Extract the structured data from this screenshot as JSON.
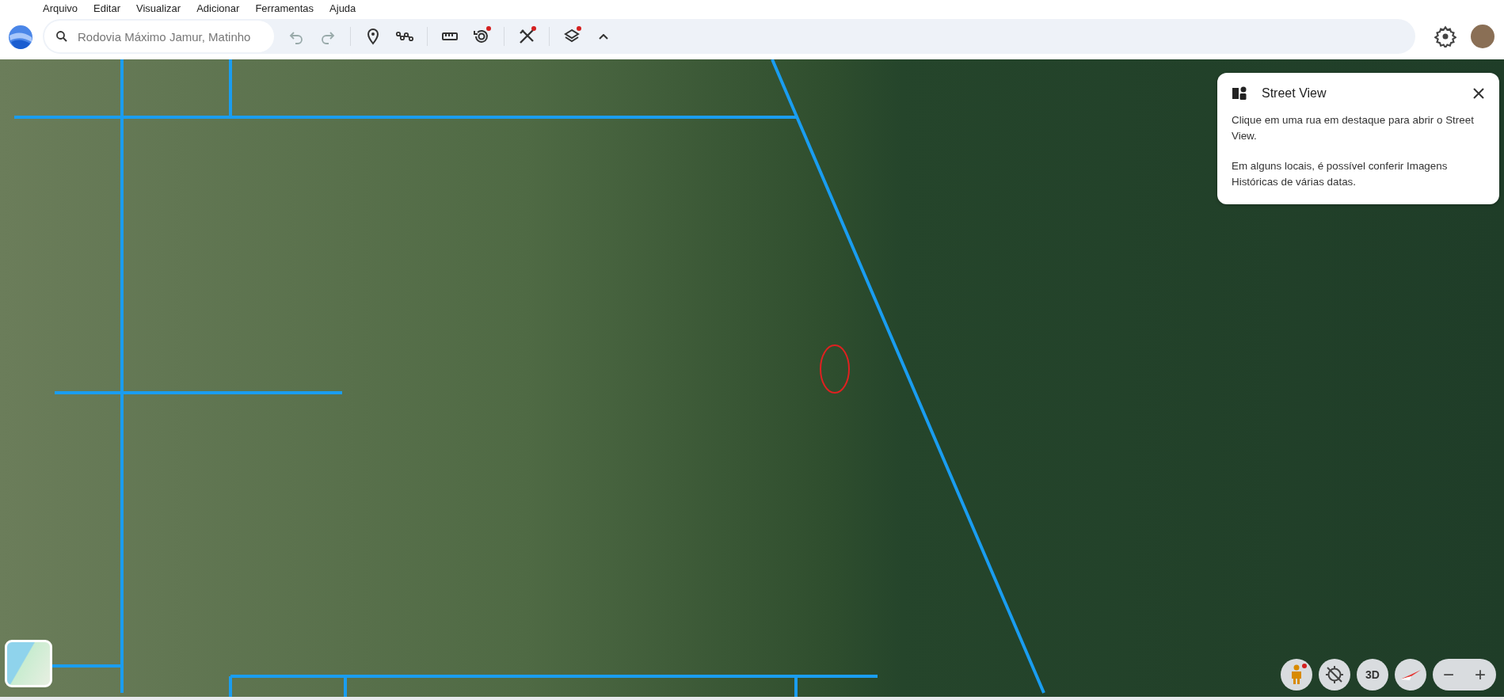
{
  "menu": [
    "Arquivo",
    "Editar",
    "Visualizar",
    "Adicionar",
    "Ferramentas",
    "Ajuda"
  ],
  "search": {
    "value": "Rodovia Máximo Jamur, Matinho"
  },
  "toolbar": [
    {
      "kind": "undo",
      "disabled": true,
      "dot": false
    },
    {
      "kind": "redo",
      "disabled": true,
      "dot": false
    },
    {
      "kind": "separator"
    },
    {
      "kind": "pin",
      "disabled": false,
      "dot": false
    },
    {
      "kind": "path",
      "disabled": false,
      "dot": false
    },
    {
      "kind": "separator"
    },
    {
      "kind": "ruler",
      "disabled": false,
      "dot": false
    },
    {
      "kind": "history",
      "disabled": false,
      "dot": true
    },
    {
      "kind": "separator"
    },
    {
      "kind": "tools",
      "disabled": false,
      "dot": true
    },
    {
      "kind": "separator"
    },
    {
      "kind": "layers",
      "disabled": false,
      "dot": true
    },
    {
      "kind": "collapse",
      "disabled": false,
      "dot": false
    }
  ],
  "street_view_panel": {
    "title": "Street View",
    "paragraphs": [
      "Clique em uma rua em destaque para abrir o Street View.",
      "Em alguns locais, é possível conferir Imagens Históricas de várias datas."
    ]
  },
  "map_controls": [
    {
      "kind": "pegman",
      "dot": true
    },
    {
      "kind": "recenter",
      "dot": false
    },
    {
      "kind": "text",
      "label": "3D",
      "dot": false
    },
    {
      "kind": "compass",
      "dot": false
    }
  ],
  "zoom": {
    "out": "−",
    "in": "+"
  }
}
